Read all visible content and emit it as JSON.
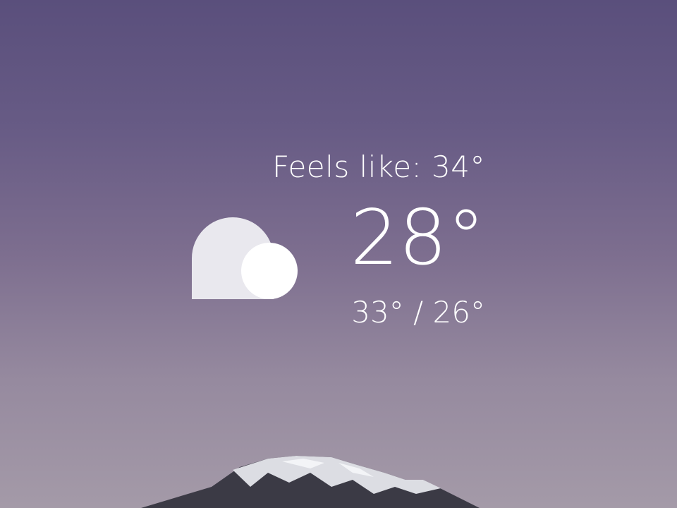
{
  "weather": {
    "condition_icon": "partly-cloudy-icon",
    "feels_like": "Feels like: 34°",
    "current_temp": "28°",
    "hi_lo": "33° / 26°"
  },
  "colors": {
    "sky_top": "#5a4f7c",
    "sky_bottom": "#a49aa8",
    "text": "#ffffff",
    "cloud_back": "#e9e8ee",
    "cloud_front": "#ffffff"
  }
}
